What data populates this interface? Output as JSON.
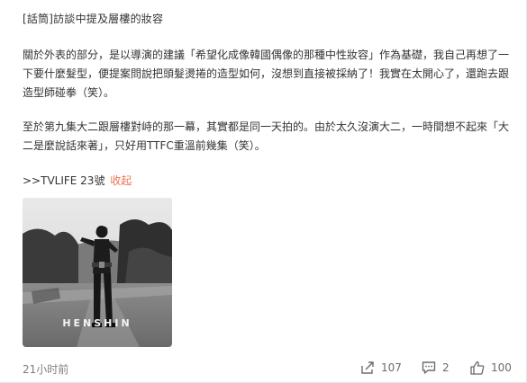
{
  "post": {
    "title": "[話筒]訪談中提及層樓的妝容",
    "paragraph1": "關於外表的部分，是以導演的建議「希望化成像韓國偶像的那種中性妝容」作為基礎，我自己再想了一下要什麼髮型，便提案問說把頭髮燙捲的造型如何，沒想到直接被採納了！我實在太開心了，還跑去跟造型師碰拳（笑）。",
    "paragraph2": "至於第九集大二跟層樓對峙的那一幕，其實都是同一天拍的。由於太久沒演大二，一時間想不起來「大二是麼說話來著」，只好用TTFC重溫前幾集（笑）。",
    "source": ">>TVLIFE 23號",
    "collapse_label": "收起",
    "photo_caption": "HENSHIN"
  },
  "footer": {
    "time": "21小时前",
    "share_count": "107",
    "comment_count": "2",
    "like_count": "100",
    "share_icon": "share-icon",
    "comment_icon": "comment-icon",
    "like_icon": "thumbs-up-icon"
  },
  "colors": {
    "text": "#333333",
    "meta": "#808080",
    "accent": "#eb7350"
  }
}
